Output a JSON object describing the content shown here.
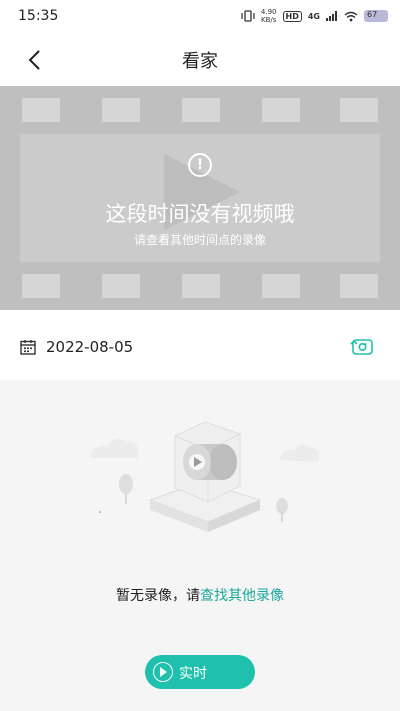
{
  "status_bar": {
    "time": "15:35",
    "net_speed_value": "4.90",
    "net_speed_unit": "KB/s",
    "hd_label": "HD",
    "network_label": "4G",
    "battery_text": "67"
  },
  "header": {
    "title": "看家",
    "back_icon": "chevron-left-icon"
  },
  "video": {
    "title": "这段时间没有视频哦",
    "subtitle": "请查看其他时间点的录像",
    "warning_icon": "exclamation-circle-icon"
  },
  "date_row": {
    "date": "2022-08-05",
    "calendar_icon": "calendar-icon",
    "switch_icon": "swap-icon"
  },
  "empty_state": {
    "message_prefix": "暂无录像，请",
    "link_text": "查找其他录像",
    "illustration": "video-cube-illustration"
  },
  "live_button": {
    "label": "实时",
    "icon": "play-circle-icon"
  },
  "colors": {
    "accent": "#1fc1ad",
    "link": "#1aa99a",
    "video_bg": "#bfbfbf",
    "panel_bg": "#f5f5f5"
  }
}
